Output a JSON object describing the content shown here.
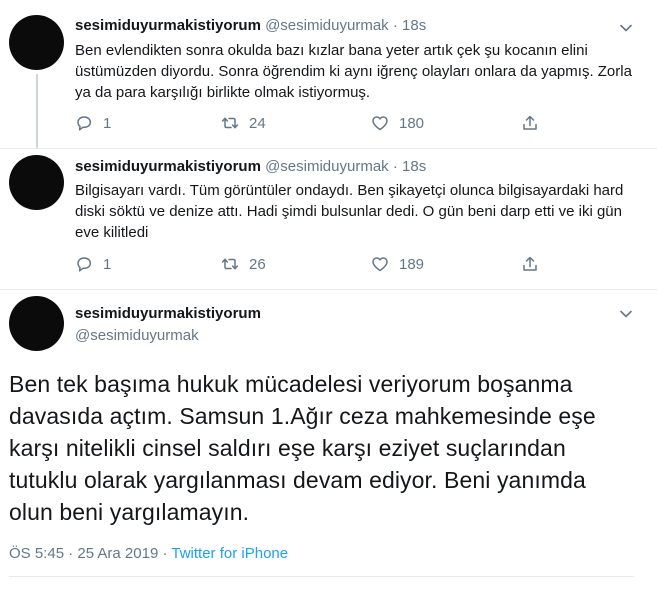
{
  "tweets": [
    {
      "display_name": "sesimiduyurmakistiyorum",
      "handle": "@sesimiduyurmak",
      "sep": "·",
      "time": "18s",
      "text": "Ben evlendikten sonra okulda bazı kızlar bana yeter artık çek şu kocanın elini üstümüzden diyordu. Sonra öğrendim ki aynı iğrenç olayları onlara da yapmış. Zorla ya da para karşılığı birlikte olmak istiyormuş.",
      "replies": "1",
      "retweets": "24",
      "likes": "180"
    },
    {
      "display_name": "sesimiduyurmakistiyorum",
      "handle": "@sesimiduyurmak",
      "sep": "·",
      "time": "18s",
      "text": "Bilgisayarı vardı. Tüm görüntüler ondaydı. Ben şikayetçi olunca bilgisayardaki hard diski söktü ve denize attı. Hadi şimdi bulsunlar dedi. O gün beni darp etti ve iki gün eve kilitledi",
      "replies": "1",
      "retweets": "26",
      "likes": "189"
    }
  ],
  "main_tweet": {
    "display_name": "sesimiduyurmakistiyorum",
    "handle": "@sesimiduyurmak",
    "text": "Ben tek başıma hukuk mücadelesi veriyorum boşanma davasıda açtım. Samsun 1.Ağır ceza mahkemesinde eşe karşı nitelikli cinsel saldırı eşe karşı eziyet suçlarından tutuklu olarak yargılanması devam ediyor. Beni yanımda olun beni yargılamayın.",
    "time": "ÖS 5:45",
    "date": "25 Ara 2019",
    "sep": "·",
    "source": "Twitter for iPhone"
  },
  "colors": {
    "text": "#14171a",
    "secondary": "#657786",
    "link": "#1da1f2",
    "divider": "#e6ecf0"
  },
  "icons": [
    "reply-icon",
    "retweet-icon",
    "like-icon",
    "share-icon",
    "caret-down-icon"
  ]
}
